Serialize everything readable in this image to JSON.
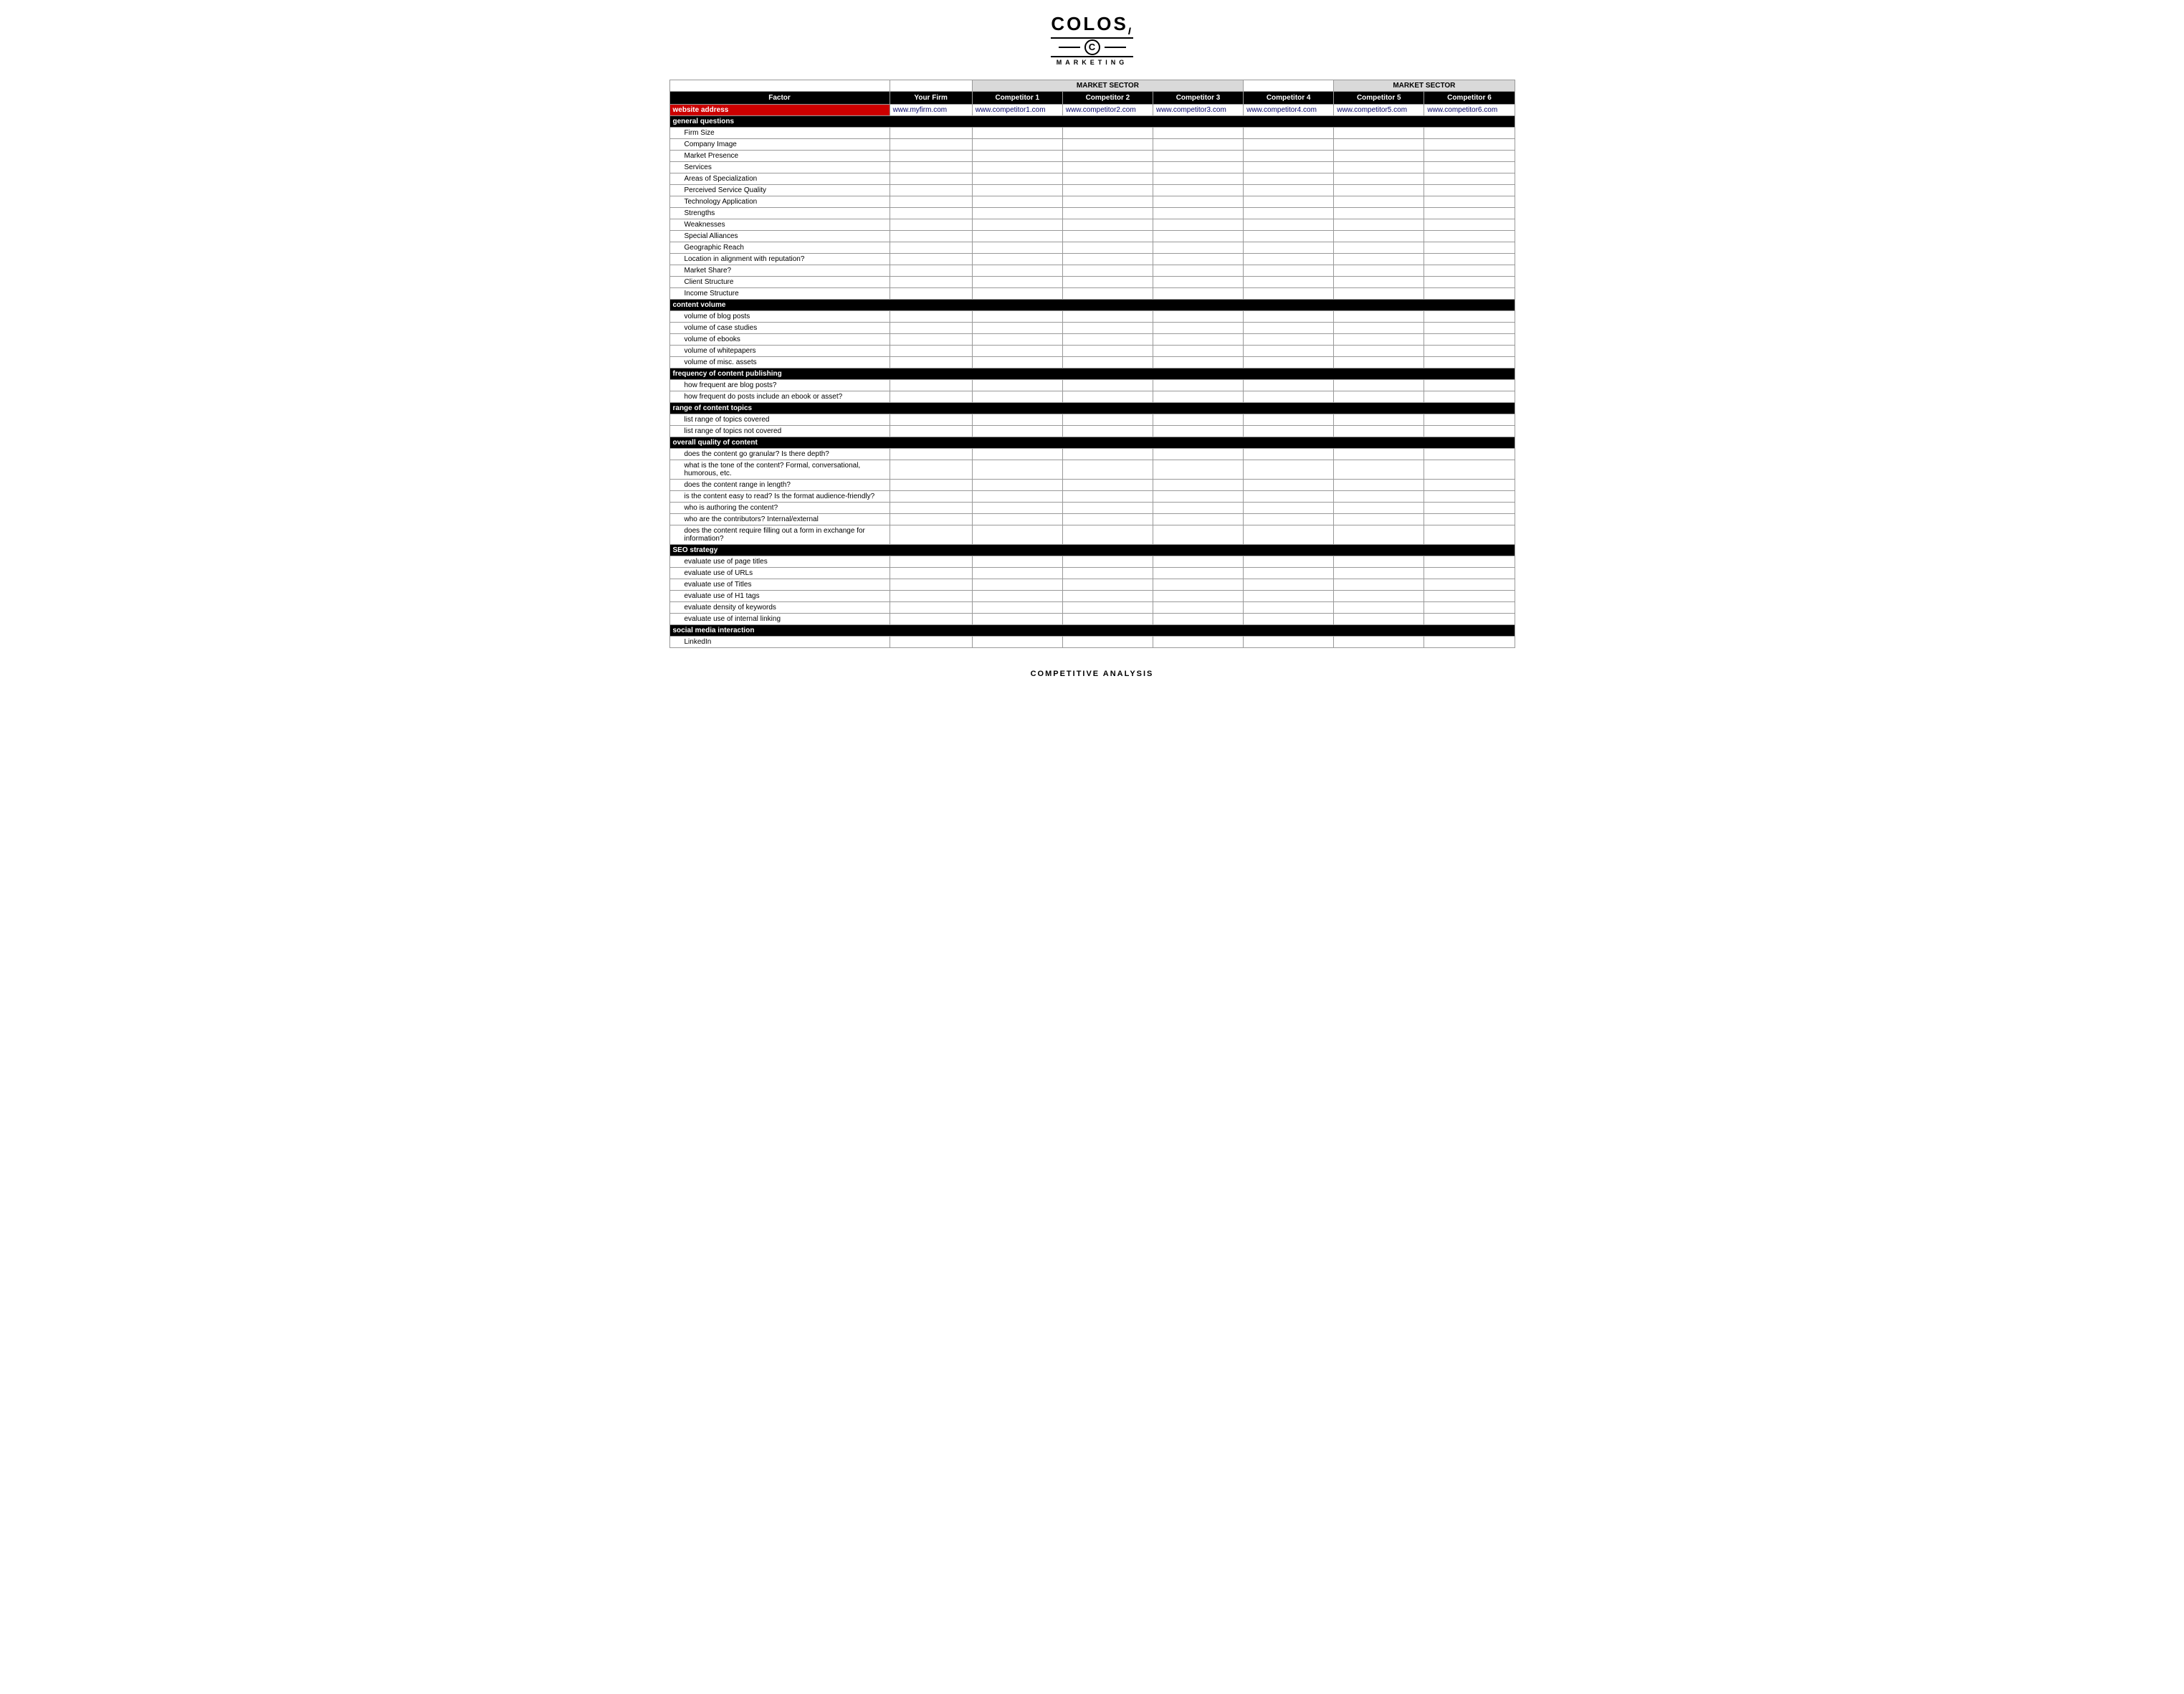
{
  "logo": {
    "top": "COLOS",
    "circle_letter": "C",
    "bottom": "MARKETING",
    "subtitle": "COMPETITIVE ANALYSIS"
  },
  "header": {
    "market_sector_label": "MARKET SECTOR",
    "market_sector_label2": "MARKET SECTOR"
  },
  "columns": {
    "factor": "Factor",
    "your_firm": "Your Firm",
    "competitor1": "Competitor 1",
    "competitor2": "Competitor 2",
    "competitor3": "Competitor 3",
    "competitor4": "Competitor 4",
    "competitor5": "Competitor 5",
    "competitor6": "Competitor 6"
  },
  "website_row": {
    "label": "website address",
    "your_firm_url": "www.myfirm.com",
    "comp1_url": "www.competitor1.com",
    "comp2_url": "www.competitor2.com",
    "comp3_url": "www.competitor3.com",
    "comp4_url": "www.competitor4.com",
    "comp5_url": "www.competitor5.com",
    "comp6_url": "www.competitor6.com"
  },
  "sections": [
    {
      "label": "general questions",
      "type": "section",
      "rows": [
        {
          "label": "Firm Size"
        },
        {
          "label": "Company Image"
        },
        {
          "label": "Market Presence"
        },
        {
          "label": "Services"
        },
        {
          "label": "Areas of Specialization"
        },
        {
          "label": "Perceived Service Quality"
        },
        {
          "label": "Technology Application"
        },
        {
          "label": "Strengths"
        },
        {
          "label": "Weaknesses"
        },
        {
          "label": "Special Alliances"
        },
        {
          "label": "Geographic Reach"
        },
        {
          "label": "Location in alignment with reputation?"
        },
        {
          "label": "Market Share?"
        },
        {
          "label": "Client Structure"
        },
        {
          "label": "Income Structure"
        }
      ]
    },
    {
      "label": "content volume",
      "type": "section",
      "rows": [
        {
          "label": "volume of blog posts"
        },
        {
          "label": "volume of case studies"
        },
        {
          "label": "volume of ebooks"
        },
        {
          "label": "volume of whitepapers"
        },
        {
          "label": "volume of misc. assets"
        }
      ]
    },
    {
      "label": "frequency of content publishing",
      "type": "section",
      "rows": [
        {
          "label": "how frequent are blog posts?"
        },
        {
          "label": "how frequent do posts include an ebook or asset?"
        }
      ]
    },
    {
      "label": "range of content topics",
      "type": "section",
      "rows": [
        {
          "label": "list range of topics covered"
        },
        {
          "label": "list range of topics not covered"
        }
      ]
    },
    {
      "label": "overall quality of content",
      "type": "section",
      "rows": [
        {
          "label": "does the content go granular? Is there depth?"
        },
        {
          "label": "what is the tone of the content? Formal, conversational, humorous, etc."
        },
        {
          "label": "does the content range in length?"
        },
        {
          "label": "is the content easy to read? Is the format audience-friendly?"
        },
        {
          "label": "who is authoring the content?"
        },
        {
          "label": "who are the contributors? Internal/external"
        },
        {
          "label": "does the content require filling out a form in exchange for information?"
        }
      ]
    },
    {
      "label": "SEO strategy",
      "type": "section",
      "rows": [
        {
          "label": "evaluate use of page titles"
        },
        {
          "label": "evaluate use of URLs"
        },
        {
          "label": "evaluate use of Titles"
        },
        {
          "label": "evaluate use of H1 tags"
        },
        {
          "label": "evaluate density of keywords"
        },
        {
          "label": "evaluate use of internal linking"
        }
      ]
    },
    {
      "label": "social media interaction",
      "type": "section",
      "rows": [
        {
          "label": "LinkedIn"
        }
      ]
    }
  ]
}
